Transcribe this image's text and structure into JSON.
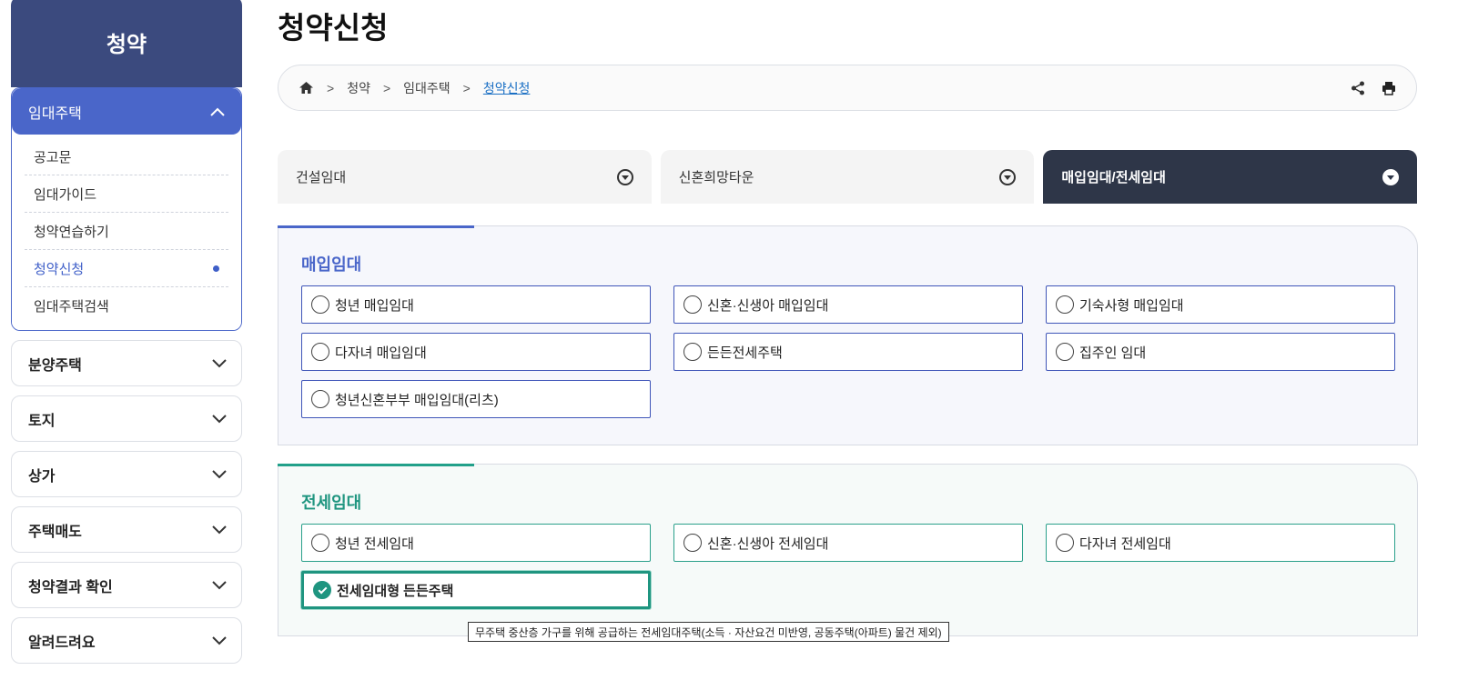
{
  "sidebar": {
    "header": "청약",
    "open_section": {
      "label": "임대주택",
      "items": [
        {
          "label": "공고문"
        },
        {
          "label": "임대가이드"
        },
        {
          "label": "청약연습하기"
        },
        {
          "label": "청약신청"
        },
        {
          "label": "임대주택검색"
        }
      ],
      "active_item": "청약신청"
    },
    "sections": [
      {
        "label": "분양주택"
      },
      {
        "label": "토지"
      },
      {
        "label": "상가"
      },
      {
        "label": "주택매도"
      },
      {
        "label": "청약결과 확인"
      },
      {
        "label": "알려드려요"
      }
    ]
  },
  "page": {
    "title": "청약신청"
  },
  "breadcrumb": {
    "items": [
      "청약",
      "임대주택",
      "청약신청"
    ],
    "separator": ">",
    "home_icon": "home-icon",
    "tools": [
      "share-icon",
      "print-icon"
    ]
  },
  "tabs": [
    {
      "label": "건설임대",
      "active": false
    },
    {
      "label": "신혼희망타운",
      "active": false
    },
    {
      "label": "매입임대/전세임대",
      "active": true
    }
  ],
  "sections": {
    "purchase": {
      "title": "매입임대",
      "accent_color": "#4a66c9",
      "options": [
        {
          "label": "청년 매입임대",
          "checked": false
        },
        {
          "label": "신혼·신생아 매입임대",
          "checked": false
        },
        {
          "label": "기숙사형 매입임대",
          "checked": false
        },
        {
          "label": "다자녀 매입임대",
          "checked": false
        },
        {
          "label": "든든전세주택",
          "checked": false
        },
        {
          "label": "집주인 임대",
          "checked": false
        },
        {
          "label": "청년신혼부부 매입임대(리츠)",
          "checked": false
        }
      ]
    },
    "jeonse": {
      "title": "전세임대",
      "accent_color": "#1f9580",
      "options": [
        {
          "label": "청년 전세임대",
          "checked": false
        },
        {
          "label": "신혼·신생아 전세임대",
          "checked": false
        },
        {
          "label": "다자녀 전세임대",
          "checked": false
        },
        {
          "label": "전세임대형 든든주택",
          "checked": true
        }
      ]
    }
  },
  "tooltip": {
    "text": "무주택 중산층 가구를 위해 공급하는 전세임대주택(소득 · 자산요건 미반영, 공동주택(아파트) 물건 제외)"
  },
  "colors": {
    "sidebar_header": "#3b4a7e",
    "sidebar_active": "#4a66c9",
    "tab_active": "#2e3648",
    "link": "#1a6fc4"
  }
}
